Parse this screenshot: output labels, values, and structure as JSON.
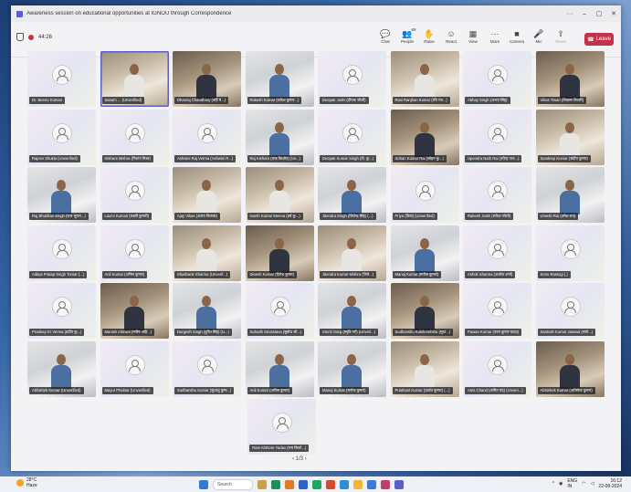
{
  "window": {
    "title": "Awareness session on educational opportunities at IGNOU through Correspondence",
    "timer": "44:26"
  },
  "toolbar": {
    "tools": [
      {
        "label": "Chat",
        "icon": "chat-icon"
      },
      {
        "label": "People",
        "icon": "people-icon",
        "count": "69"
      },
      {
        "label": "Raise",
        "icon": "raise-hand-icon"
      },
      {
        "label": "React",
        "icon": "react-icon"
      },
      {
        "label": "View",
        "icon": "view-icon"
      },
      {
        "label": "More",
        "icon": "more-icon"
      },
      {
        "label": "Camera",
        "icon": "camera-icon"
      },
      {
        "label": "Mic",
        "icon": "mic-icon"
      },
      {
        "label": "Share",
        "icon": "share-icon"
      }
    ],
    "leave_label": "Leave"
  },
  "participants": [
    {
      "name": "Dr. Beenu Kumari",
      "kind": "avatar"
    },
    {
      "name": "Sanam ... (Unverified)",
      "kind": "video"
    },
    {
      "name": "Dhanraj Chaudhary (वर्ड़ि मे...)",
      "kind": "video2"
    },
    {
      "name": "Rakesh Kumar (राकेश कुमार...)",
      "kind": "video3"
    },
    {
      "name": "Deepak Joshi (दीपक जोशी)",
      "kind": "avatar"
    },
    {
      "name": "Ravi Ranjhan Kumar (रवि रंज...)",
      "kind": "video"
    },
    {
      "name": "Abhay Singh (अभय सिंह)",
      "kind": "avatar"
    },
    {
      "name": "Vikas Tiwari (विकास तिवारी)",
      "kind": "video2"
    },
    {
      "name": "Rajeev Shukla (Unverified)",
      "kind": "avatar"
    },
    {
      "name": "Nishant Mishra (निशांत मिश्रा)",
      "kind": "avatar"
    },
    {
      "name": "Ashwini Raj Verma (Ashwini R...)",
      "kind": "avatar"
    },
    {
      "name": "Raj Kishore (राज किशोर) (Un...)",
      "kind": "video3"
    },
    {
      "name": "Deepak Kumar Singh (दी. कु...)",
      "kind": "avatar"
    },
    {
      "name": "Sohan Kumar Rai (सोहन कु...)",
      "kind": "video2"
    },
    {
      "name": "Upendra Nath Rai (उपेन्द्र नाथ...)",
      "kind": "avatar"
    },
    {
      "name": "Sandeep Kumar (संदीप कुमार)",
      "kind": "video"
    },
    {
      "name": "Raj Bhushan Singh (राज भूषण...)",
      "kind": "video3"
    },
    {
      "name": "Laxmi Kumari (लक्ष्मी कुमारी)",
      "kind": "avatar"
    },
    {
      "name": "Ajay Vikas (अजय विकास)",
      "kind": "video"
    },
    {
      "name": "Harsh Kumar Meena (हर्ष कु...)",
      "kind": "video"
    },
    {
      "name": "Jitendra Singh (जितेन्द्र सिंह) (...)",
      "kind": "video3"
    },
    {
      "name": "Priya (प्रिया) (Unverified)",
      "kind": "avatar"
    },
    {
      "name": "Rakesh Joshi (राकेश जोशी)",
      "kind": "avatar"
    },
    {
      "name": "Umesh Rai (उमेश राय)",
      "kind": "video3"
    },
    {
      "name": "Aditya Pratap Singh Tomar (...)",
      "kind": "avatar"
    },
    {
      "name": "Anil Kumar (अनिल कुमार)",
      "kind": "avatar"
    },
    {
      "name": "Shashank Sharma (Unverif...)",
      "kind": "video"
    },
    {
      "name": "Dinesh Kumar (दिनेश कुमार)",
      "kind": "video2"
    },
    {
      "name": "Jitendra Kumar Mishra (जिते...)",
      "kind": "video"
    },
    {
      "name": "Manoj Kumar (मनोज कुमार)",
      "kind": "video3"
    },
    {
      "name": "Ashok Sharma (अशोक शर्मा)",
      "kind": "avatar"
    },
    {
      "name": "Sonu Rastogi (.)",
      "kind": "avatar"
    },
    {
      "name": "Pradeep Kr Verma (प्रदीप कु...)",
      "kind": "avatar"
    },
    {
      "name": "Manish Ahirwal (मनीष अहि...)",
      "kind": "video2"
    },
    {
      "name": "Durgesh Singh (दुर्गेश सिंह) (U...)",
      "kind": "video3"
    },
    {
      "name": "Subodh Srivastava (सुबोध श्री...)",
      "kind": "avatar"
    },
    {
      "name": "Smriti Garg (स्मृति गर्ग) (Unveri...)",
      "kind": "video3"
    },
    {
      "name": "Sudhanshu Kulshreshtha (सुधां...)",
      "kind": "video2"
    },
    {
      "name": "Pawan Kumar (पवन कुमार यादव)",
      "kind": "avatar"
    },
    {
      "name": "Santosh Kumar Jaiswal (संतो...)",
      "kind": "avatar"
    },
    {
      "name": "Abhishek Kumar (Unverified)",
      "kind": "video3"
    },
    {
      "name": "Mayur Phalnar (Unverified)",
      "kind": "avatar"
    },
    {
      "name": "Sudhanshu Kumar (सुधांशु कुमा...)",
      "kind": "avatar"
    },
    {
      "name": "Anil Kumar (अनिल कुमार)",
      "kind": "video3"
    },
    {
      "name": "Manoj Kumar (मनोज कुमार)",
      "kind": "video3"
    },
    {
      "name": "Prashant Kumar (प्रशांत कुमार) (...)",
      "kind": "video"
    },
    {
      "name": "Amit Chand (अमित चंद) (Unveri...)",
      "kind": "avatar"
    },
    {
      "name": "Abhishek Kumar (अभिषेक कुमार)",
      "kind": "video2"
    },
    {
      "name": "Ram Kishore Yadav (राम किशो...)",
      "kind": "avatar"
    }
  ],
  "pager": {
    "text": "1/3"
  },
  "taskbar": {
    "weather_temp": "28°C",
    "weather_desc": "Haze",
    "search_placeholder": "Search",
    "language": "ENG",
    "language_sub": "IN",
    "time": "16:12",
    "date": "22-08-2024"
  },
  "colors": {
    "accent": "#5b5fc7",
    "leave": "#c4314b"
  }
}
